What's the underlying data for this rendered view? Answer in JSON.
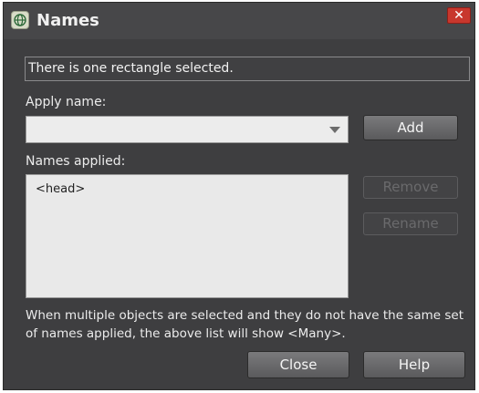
{
  "window": {
    "title": "Names",
    "icon": "globe-icon",
    "close_glyph": "✕"
  },
  "status": {
    "text": "There is one rectangle selected."
  },
  "apply_name": {
    "label": "Apply name:",
    "value": ""
  },
  "names_applied": {
    "label": "Names applied:",
    "items": [
      "<head>"
    ]
  },
  "buttons": {
    "add": "Add",
    "remove": "Remove",
    "rename": "Rename",
    "close": "Close",
    "help": "Help"
  },
  "info": {
    "text": "When multiple objects are selected and they do not have the same set of names applied, the above list will show <Many>."
  },
  "colors": {
    "dialog_bg": "#3e3e40",
    "close_red": "#c8372d"
  }
}
